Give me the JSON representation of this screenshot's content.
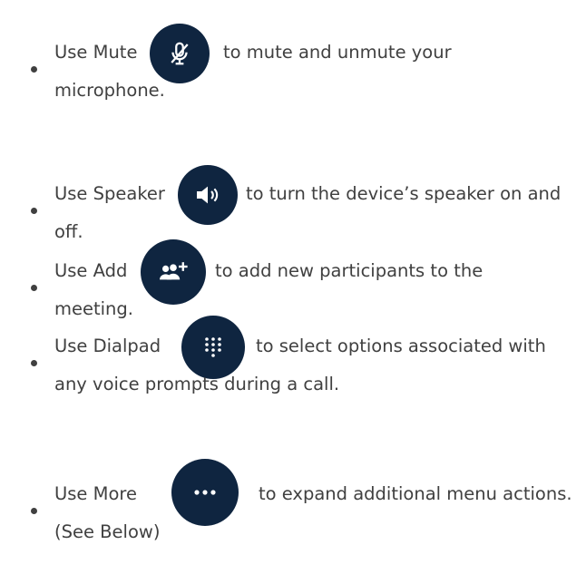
{
  "items": [
    {
      "prefix": "Use Mute",
      "suffix": "to mute and unmute your",
      "line2": "microphone.",
      "icon": "microphone-off-icon"
    },
    {
      "prefix": "Use Speaker",
      "suffix": "to turn the device’s speaker on and",
      "line2": "off.",
      "icon": "speaker-icon"
    },
    {
      "prefix": "Use Add",
      "suffix": "to add new participants to the",
      "line2": "meeting.",
      "icon": "add-people-icon"
    },
    {
      "prefix": "Use Dialpad",
      "suffix": "to select options associated with",
      "line2": "any voice prompts during a call.",
      "icon": "dialpad-icon"
    },
    {
      "prefix": "Use More",
      "suffix": "to expand additional menu actions.",
      "line2": "(See Below)",
      "icon": "more-icon"
    }
  ],
  "colors": {
    "text": "#404040",
    "icon_background": "#0f2540",
    "icon_glyph": "#ffffff"
  }
}
